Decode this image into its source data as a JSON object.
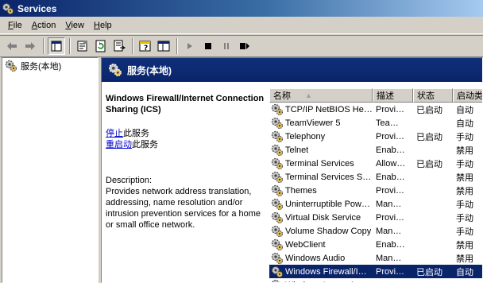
{
  "window": {
    "title": "Services"
  },
  "menu": [
    "File",
    "Action",
    "View",
    "Help"
  ],
  "toolbar": [
    "back-icon",
    "forward-icon",
    "show-hide-tree-icon",
    "properties-icon",
    "refresh-icon",
    "export-list-icon",
    "help-icon",
    "console-window-icon",
    "start-icon",
    "stop-icon",
    "pause-icon",
    "restart-icon"
  ],
  "tree": {
    "root_label": "服务(本地)"
  },
  "pane": {
    "header": "服务(本地)"
  },
  "details": {
    "service_name": "Windows Firewall/Internet Connection Sharing (ICS)",
    "stop_link": "停止",
    "stop_suffix": "此服务",
    "restart_link": "重启动",
    "restart_suffix": "此服务",
    "description_label": "Description:",
    "description": "Provides network address translation, addressing, name resolution and/or intrusion prevention services for a home or small office network."
  },
  "columns": {
    "name": "名称",
    "desc": "描述",
    "status": "状态",
    "startup": "启动类"
  },
  "services": [
    {
      "name": "TCP/IP NetBIOS He…",
      "desc": "Provi…",
      "status": "已启动",
      "startup": "自动"
    },
    {
      "name": "TeamViewer 5",
      "desc": "Tea…",
      "status": "",
      "startup": "自动"
    },
    {
      "name": "Telephony",
      "desc": "Provi…",
      "status": "已启动",
      "startup": "手动"
    },
    {
      "name": "Telnet",
      "desc": "Enab…",
      "status": "",
      "startup": "禁用"
    },
    {
      "name": "Terminal Services",
      "desc": "Allow…",
      "status": "已启动",
      "startup": "手动"
    },
    {
      "name": "Terminal Services S…",
      "desc": "Enab…",
      "status": "",
      "startup": "禁用"
    },
    {
      "name": "Themes",
      "desc": "Provi…",
      "status": "",
      "startup": "禁用"
    },
    {
      "name": "Uninterruptible Pow…",
      "desc": "Man…",
      "status": "",
      "startup": "手动"
    },
    {
      "name": "Virtual Disk Service",
      "desc": "Provi…",
      "status": "",
      "startup": "手动"
    },
    {
      "name": "Volume Shadow Copy",
      "desc": "Man…",
      "status": "",
      "startup": "手动"
    },
    {
      "name": "WebClient",
      "desc": "Enab…",
      "status": "",
      "startup": "禁用"
    },
    {
      "name": "Windows Audio",
      "desc": "Man…",
      "status": "",
      "startup": "禁用"
    },
    {
      "name": "Windows Firewall/I…",
      "desc": "Provi…",
      "status": "已启动",
      "startup": "自动",
      "selected": true
    },
    {
      "name": "Windows Image Acq…",
      "desc": "",
      "status": "",
      "startup": ""
    }
  ]
}
